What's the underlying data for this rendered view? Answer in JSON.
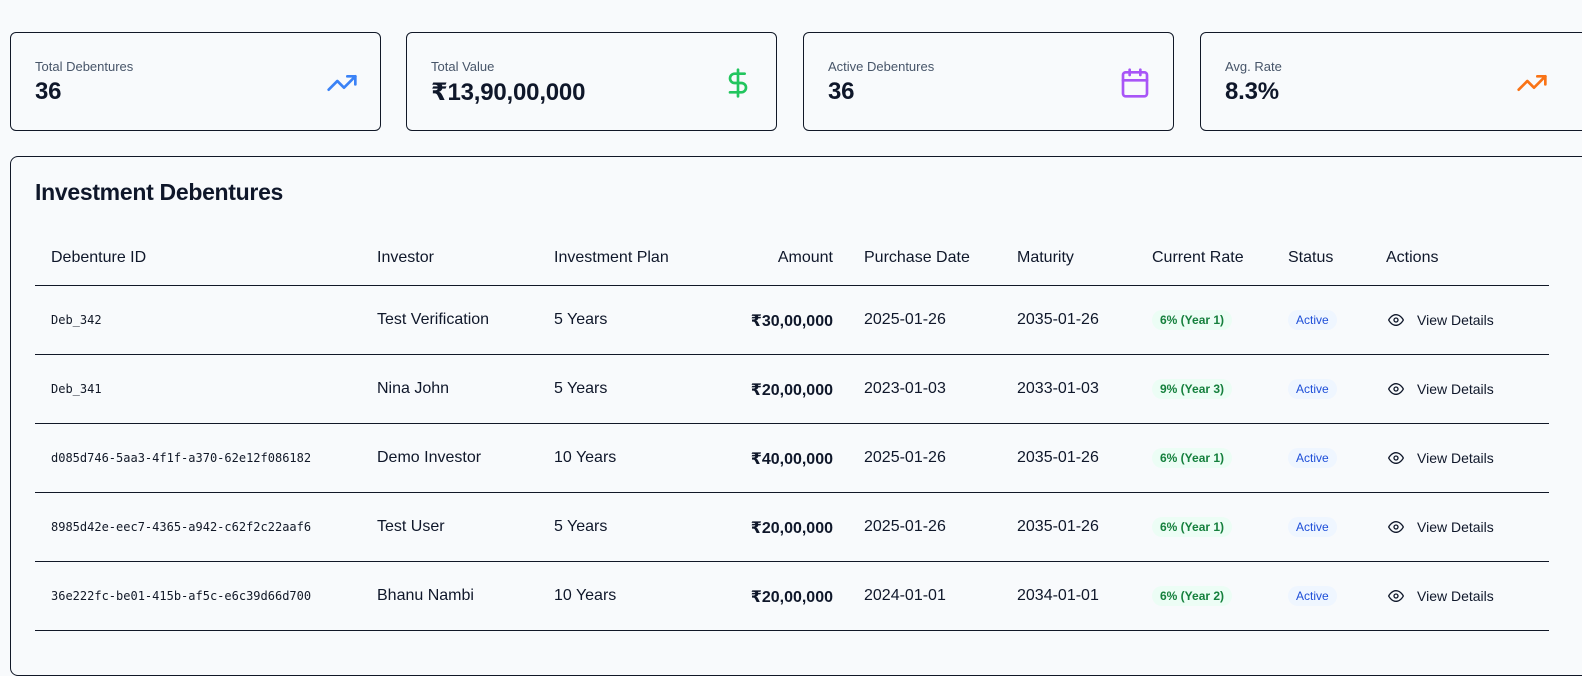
{
  "stats": [
    {
      "label": "Total Debentures",
      "value": "36",
      "icon": "trending-up-icon",
      "color": "#3b82f6"
    },
    {
      "label": "Total Value",
      "value": "₹13,90,00,000",
      "icon": "dollar-icon",
      "color": "#22c55e"
    },
    {
      "label": "Active Debentures",
      "value": "36",
      "icon": "calendar-icon",
      "color": "#a855f7"
    },
    {
      "label": "Avg. Rate",
      "value": "8.3%",
      "icon": "trending-up-icon",
      "color": "#f97316"
    }
  ],
  "panel": {
    "title": "Investment Debentures"
  },
  "table": {
    "headers": {
      "id": "Debenture ID",
      "investor": "Investor",
      "plan": "Investment Plan",
      "amount": "Amount",
      "purchase": "Purchase Date",
      "maturity": "Maturity",
      "rate": "Current Rate",
      "status": "Status",
      "actions": "Actions"
    },
    "rows": [
      {
        "id": "Deb_342",
        "investor": "Test Verification",
        "plan": "5 Years",
        "amount": "₹30,00,000",
        "purchase": "2025-01-26",
        "maturity": "2035-01-26",
        "rate": "6% (Year 1)",
        "status": "Active",
        "action": "View Details"
      },
      {
        "id": "Deb_341",
        "investor": "Nina John",
        "plan": "5 Years",
        "amount": "₹20,00,000",
        "purchase": "2023-01-03",
        "maturity": "2033-01-03",
        "rate": "9% (Year 3)",
        "status": "Active",
        "action": "View Details"
      },
      {
        "id": "d085d746-5aa3-4f1f-a370-62e12f086182",
        "investor": "Demo Investor",
        "plan": "10 Years",
        "amount": "₹40,00,000",
        "purchase": "2025-01-26",
        "maturity": "2035-01-26",
        "rate": "6% (Year 1)",
        "status": "Active",
        "action": "View Details"
      },
      {
        "id": "8985d42e-eec7-4365-a942-c62f2c22aaf6",
        "investor": "Test User",
        "plan": "5 Years",
        "amount": "₹20,00,000",
        "purchase": "2025-01-26",
        "maturity": "2035-01-26",
        "rate": "6% (Year 1)",
        "status": "Active",
        "action": "View Details"
      },
      {
        "id": "36e222fc-be01-415b-af5c-e6c39d66d700",
        "investor": "Bhanu Nambi",
        "plan": "10 Years",
        "amount": "₹20,00,000",
        "purchase": "2024-01-01",
        "maturity": "2034-01-01",
        "rate": "6% (Year 2)",
        "status": "Active",
        "action": "View Details"
      }
    ]
  }
}
